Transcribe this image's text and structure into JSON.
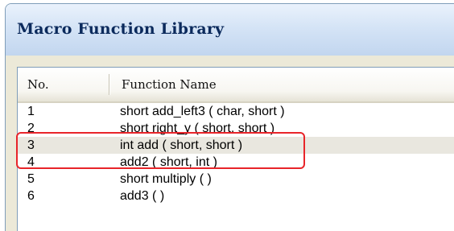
{
  "window": {
    "title": "Macro Function Library"
  },
  "list": {
    "columns": [
      "No.",
      "Function Name"
    ],
    "rows": [
      {
        "no": "1",
        "name": "short add_left3 ( char, short )"
      },
      {
        "no": "2",
        "name": "short right_y ( short, short )"
      },
      {
        "no": "3",
        "name": "int add ( short, short )",
        "selected": true
      },
      {
        "no": "4",
        "name": "add2 ( short, int )"
      },
      {
        "no": "5",
        "name": "short multiply (  )"
      },
      {
        "no": "6",
        "name": "add3 (  )"
      }
    ]
  },
  "annotation": {
    "color": "#e8252a"
  }
}
